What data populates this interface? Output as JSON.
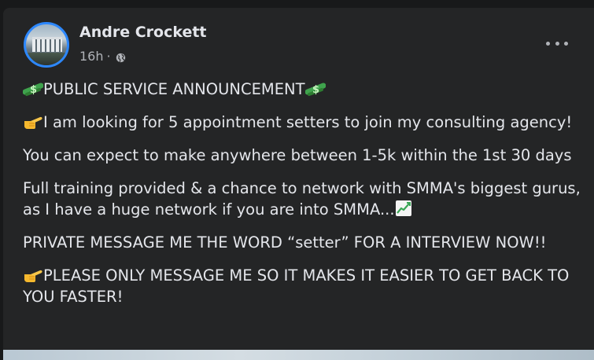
{
  "post": {
    "author": "Andre Crockett",
    "timestamp": "16h",
    "separator": "·",
    "audience_icon": "globe-icon",
    "more_icon": "more-options-icon",
    "paragraphs": [
      {
        "lead_emoji": "money-bag-icon",
        "text": "PUBLIC SERVICE ANNOUNCEMENT",
        "trail_emoji": "money-bag-icon"
      },
      {
        "lead_emoji": "pointing-hand-icon",
        "text": "I am looking for 5 appointment setters to join my consulting agency!",
        "trail_emoji": ""
      },
      {
        "lead_emoji": "",
        "text": "You can expect to make anywhere between 1-5k within the 1st 30 days",
        "trail_emoji": ""
      },
      {
        "lead_emoji": "",
        "text": "Full training provided & a chance to network with SMMA's biggest gurus, as I have a huge network if you are into SMMA...",
        "trail_emoji": "chart-increasing-icon"
      },
      {
        "lead_emoji": "",
        "text": "PRIVATE MESSAGE ME THE WORD “setter” FOR A INTERVIEW NOW!!",
        "trail_emoji": ""
      },
      {
        "lead_emoji": "pointing-hand-icon",
        "text": "PLEASE ONLY MESSAGE ME SO IT MAKES IT EASIER TO GET BACK TO YOU FASTER!",
        "trail_emoji": ""
      }
    ]
  },
  "colors": {
    "background": "#18191a",
    "card": "#242526",
    "primary_text": "#e4e6eb",
    "secondary_text": "#b0b3b8",
    "avatar_ring": "#2d88ff"
  }
}
